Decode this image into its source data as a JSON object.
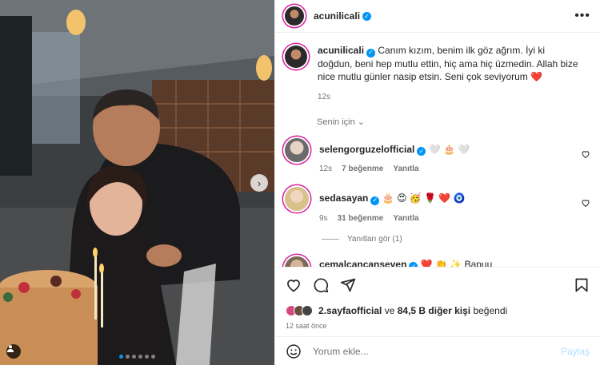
{
  "post": {
    "author": "acunilicali",
    "caption": "Canım kızım, benim ilk göz ağrım. İyi ki doğdun, beni hep mutlu ettin, hiç ama hiç üzmedin. Allah bize nice mutlu günler nasip etsin. Seni çok seviyorum ❤️",
    "caption_age": "12s"
  },
  "filter_label": "Senin için ⌄",
  "comments": [
    {
      "user": "selengorguzelofficial",
      "text": "🤍 🎂 🤍",
      "age": "12s",
      "likes": "7 beğenme",
      "reply": "Yanıtla"
    },
    {
      "user": "sedasayan",
      "text": "🎂 😍 🥳 🌹 ❤️ 🧿",
      "age": "9s",
      "likes": "31 beğenme",
      "reply": "Yanıtla",
      "view_replies": "Yanıtları gör (1)"
    },
    {
      "user": "cemalcancanseven",
      "text": "❤️ 👏 ✨ Bapuu"
    }
  ],
  "likes_line": {
    "first_liker": "2.sayfaofficial",
    "connector": " ve ",
    "others": "84,5 B diğer kişi",
    "suffix": " beğendi"
  },
  "posted_ago": "12 saat önce",
  "add_comment": {
    "placeholder": "Yorum ekle...",
    "post_label": "Paylaş"
  },
  "colors": {
    "verified": "#0095f6",
    "post_btn": "#b2dffc",
    "story_ring": "#d6249f"
  },
  "carousel": {
    "slides": 6,
    "active": 1
  }
}
